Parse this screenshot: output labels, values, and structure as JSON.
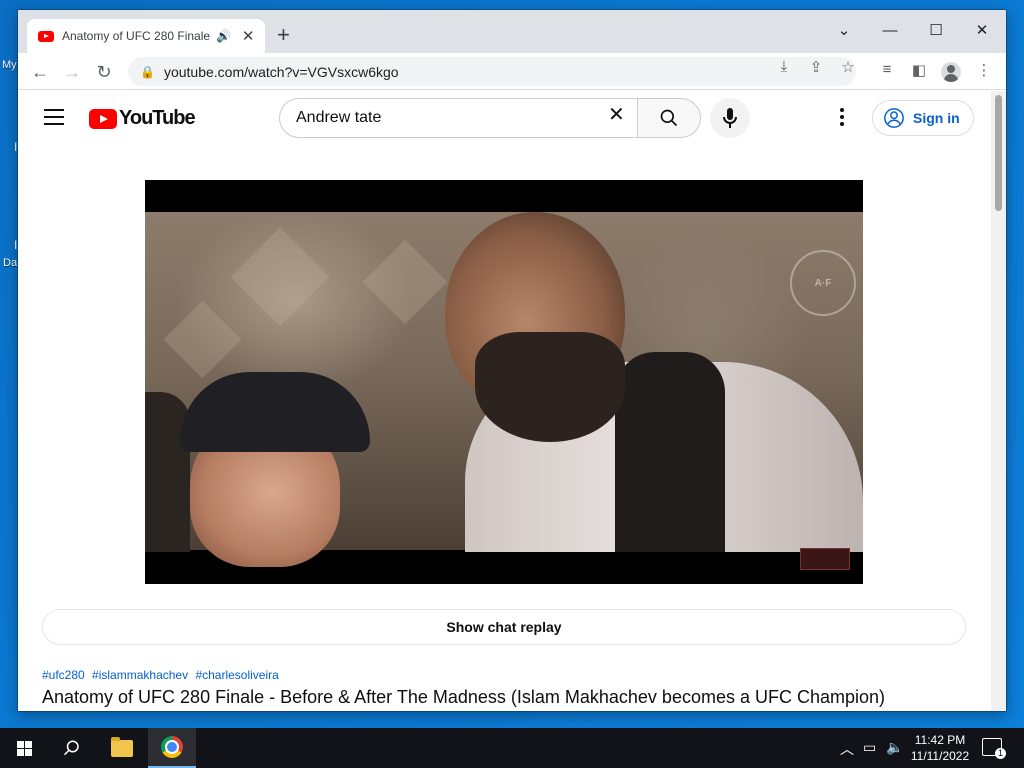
{
  "desktop": {
    "labels": [
      "My",
      "Da"
    ],
    "marks": [
      "I",
      "I"
    ]
  },
  "browser": {
    "tab_title": "Anatomy of UFC 280 Finale",
    "new_tab": "+",
    "url": "youtube.com/watch?v=VGVsxcw6kgo",
    "window_controls": {
      "dropdown": "⌄",
      "minimize": "—",
      "maximize": "☐",
      "close": "✕"
    }
  },
  "youtube": {
    "logo_text": "YouTube",
    "search": {
      "value": "Andrew tate"
    },
    "sign_in": "Sign in",
    "chat_replay": "Show chat replay",
    "hashtags": [
      "#ufc280",
      "#islammakhachev",
      "#charlesoliveira"
    ],
    "video_title": "Anatomy of UFC 280 Finale - Before & After The Madness (Islam Makhachev becomes a UFC Champion)"
  },
  "taskbar": {
    "time": "11:42 PM",
    "date": "11/11/2022",
    "notification_count": "1"
  },
  "colors": {
    "youtube_red": "#ff0000",
    "link_blue": "#065fd4",
    "taskbar": "#111318",
    "desktop": "#0a73c9"
  }
}
